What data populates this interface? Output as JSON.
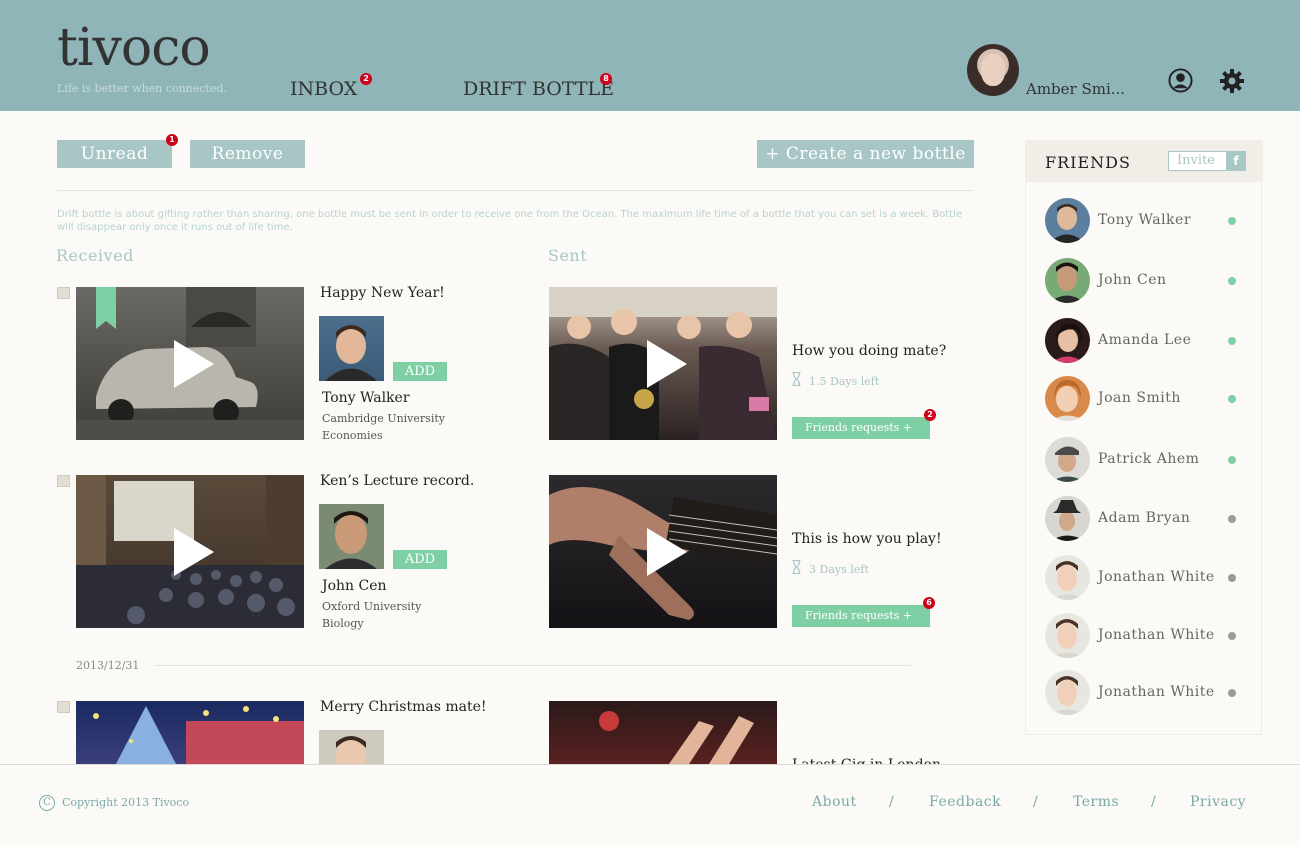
{
  "header": {
    "logo": "tivoco",
    "tagline": "Life is better when connected.",
    "nav": [
      {
        "label": "INBOX",
        "badge": "2"
      },
      {
        "label": "DRIFT BOTTLE",
        "badge": "8"
      }
    ],
    "user_name": "Amber Smi..."
  },
  "toolbar": {
    "unread_label": "Unread",
    "unread_badge": "1",
    "remove_label": "Remove",
    "create_label": "+ Create a new bottle"
  },
  "info_text": "Drift bottle is about gifting rather than sharing, one bottle must be sent in order to receive one from the Ocean. The maximum life time of a bottle that you can set is a week. Bottle will disappear only once it runs out of life time.",
  "received": {
    "title": "Received",
    "items": [
      {
        "title": "Happy New Year!",
        "add_label": "ADD",
        "name": "Tony Walker",
        "school": "Cambridge University",
        "field": "Economies"
      },
      {
        "title": "Ken’s Lecture record.",
        "add_label": "ADD",
        "name": "John Cen",
        "school": "Oxford University",
        "field": "Biology"
      },
      {
        "title": "Merry Christmas mate!"
      }
    ]
  },
  "date_separator": "2013/12/31",
  "sent": {
    "title": "Sent",
    "items": [
      {
        "title": "How you doing mate?",
        "days_left": "1.5 Days left",
        "requests_label": "Friends requests +",
        "requests_badge": "2"
      },
      {
        "title": "This is how you play!",
        "days_left": "3 Days left",
        "requests_label": "Friends requests +",
        "requests_badge": "6"
      },
      {
        "title": "Latest Gig in London"
      }
    ]
  },
  "friends": {
    "title": "FRIENDS",
    "invite_label": "Invite",
    "list": [
      {
        "name": "Tony Walker",
        "online": true
      },
      {
        "name": "John Cen",
        "online": true
      },
      {
        "name": "Amanda Lee",
        "online": true
      },
      {
        "name": "Joan Smith",
        "online": true
      },
      {
        "name": "Patrick Ahem",
        "online": true
      },
      {
        "name": "Adam Bryan",
        "online": false
      },
      {
        "name": "Jonathan White",
        "online": false
      },
      {
        "name": "Jonathan White",
        "online": false
      },
      {
        "name": "Jonathan White",
        "online": false
      }
    ]
  },
  "footer": {
    "copyright": "Copyright 2013 Tivoco",
    "links": [
      "About",
      "Feedback",
      "Terms",
      "Privacy"
    ]
  },
  "colors": {
    "header_bg": "#8fb5b8",
    "accent_teal": "#a8c6c6",
    "accent_green": "#7fcfa5",
    "badge_red": "#d0021b",
    "offline_gray": "#9a9a9a"
  }
}
